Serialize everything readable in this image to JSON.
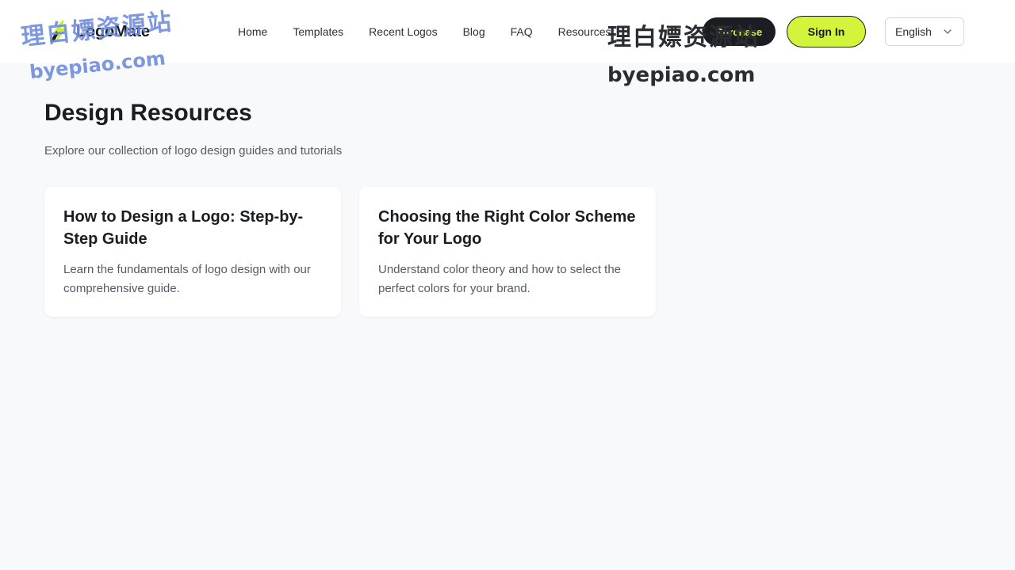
{
  "header": {
    "logo_text": "LogoMate",
    "nav": [
      {
        "label": "Home"
      },
      {
        "label": "Templates"
      },
      {
        "label": "Recent Logos"
      },
      {
        "label": "Blog"
      },
      {
        "label": "FAQ"
      },
      {
        "label": "Resources"
      }
    ],
    "purchase_label": "Purchase",
    "signin_label": "Sign In",
    "language": "English"
  },
  "main": {
    "title": "Design Resources",
    "subtitle": "Explore our collection of logo design guides and tutorials",
    "cards": [
      {
        "title": "How to Design a Logo: Step-by-Step Guide",
        "description": "Learn the fundamentals of logo design with our comprehensive guide."
      },
      {
        "title": "Choosing the Right Color Scheme for Your Logo",
        "description": "Understand color theory and how to select the perfect colors for your brand."
      }
    ]
  },
  "watermarks": {
    "cn": "理白嫖资源站",
    "en": "byepiao.com"
  },
  "colors": {
    "accent": "#d2f53c",
    "dark": "#1a1d21",
    "background": "#f8f9fb",
    "watermark_blue": "#6f8ddc"
  },
  "icons": {
    "logo": "lightning-bolt-icon",
    "language_dropdown": "chevron-down-icon"
  }
}
